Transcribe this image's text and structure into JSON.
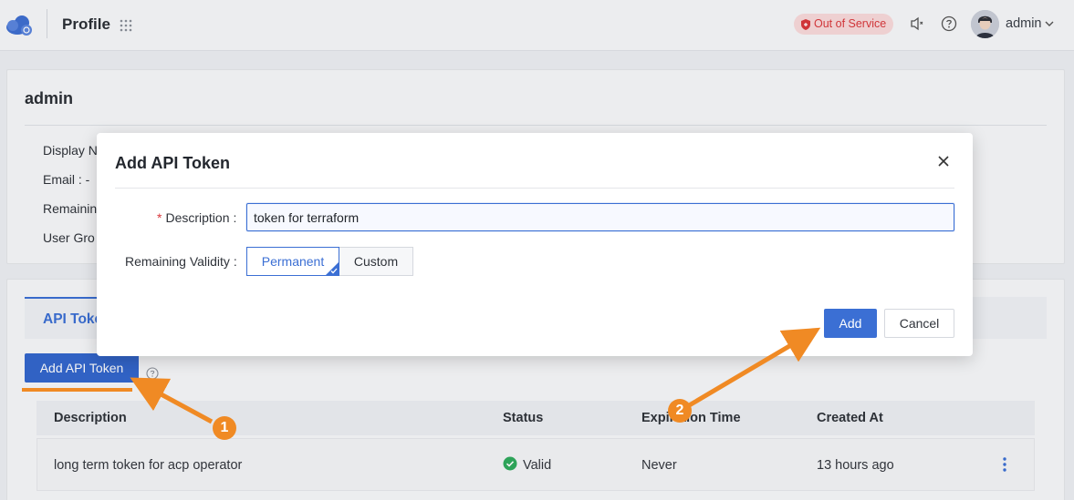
{
  "header": {
    "title": "Profile",
    "status": "Out of Service",
    "user": "admin",
    "accent": "#3b6fd4",
    "status_color": "#d9383c"
  },
  "profile": {
    "name": "admin",
    "fields": [
      {
        "label": "Display N"
      },
      {
        "label": "Email :  -"
      },
      {
        "label": "Remainin"
      },
      {
        "label": "User Gro"
      }
    ]
  },
  "tabs": {
    "active": "API Token"
  },
  "toolbar": {
    "add_label": "Add API Token"
  },
  "table": {
    "columns": [
      "Description",
      "Status",
      "Expiration Time",
      "Created At"
    ],
    "rows": [
      {
        "description": "long term token for acp operator",
        "status": "Valid",
        "expires": "Never",
        "created": "13 hours ago"
      }
    ]
  },
  "modal": {
    "title": "Add API Token",
    "description_label": "Description",
    "description_value": "token for terraform",
    "validity_label": "Remaining Validity",
    "options": [
      "Permanent",
      "Custom"
    ],
    "selected_option": "Permanent",
    "add_label": "Add",
    "cancel_label": "Cancel"
  },
  "annotations": {
    "color": "#f08a24",
    "steps": [
      "1",
      "2"
    ]
  },
  "icons": [
    "cloud-logo-icon",
    "grid-icon",
    "shield-icon",
    "speaker-icon",
    "help-icon",
    "chevron-down-icon",
    "question-icon",
    "check-circle-icon",
    "kebab-icon",
    "close-icon",
    "check-icon"
  ]
}
